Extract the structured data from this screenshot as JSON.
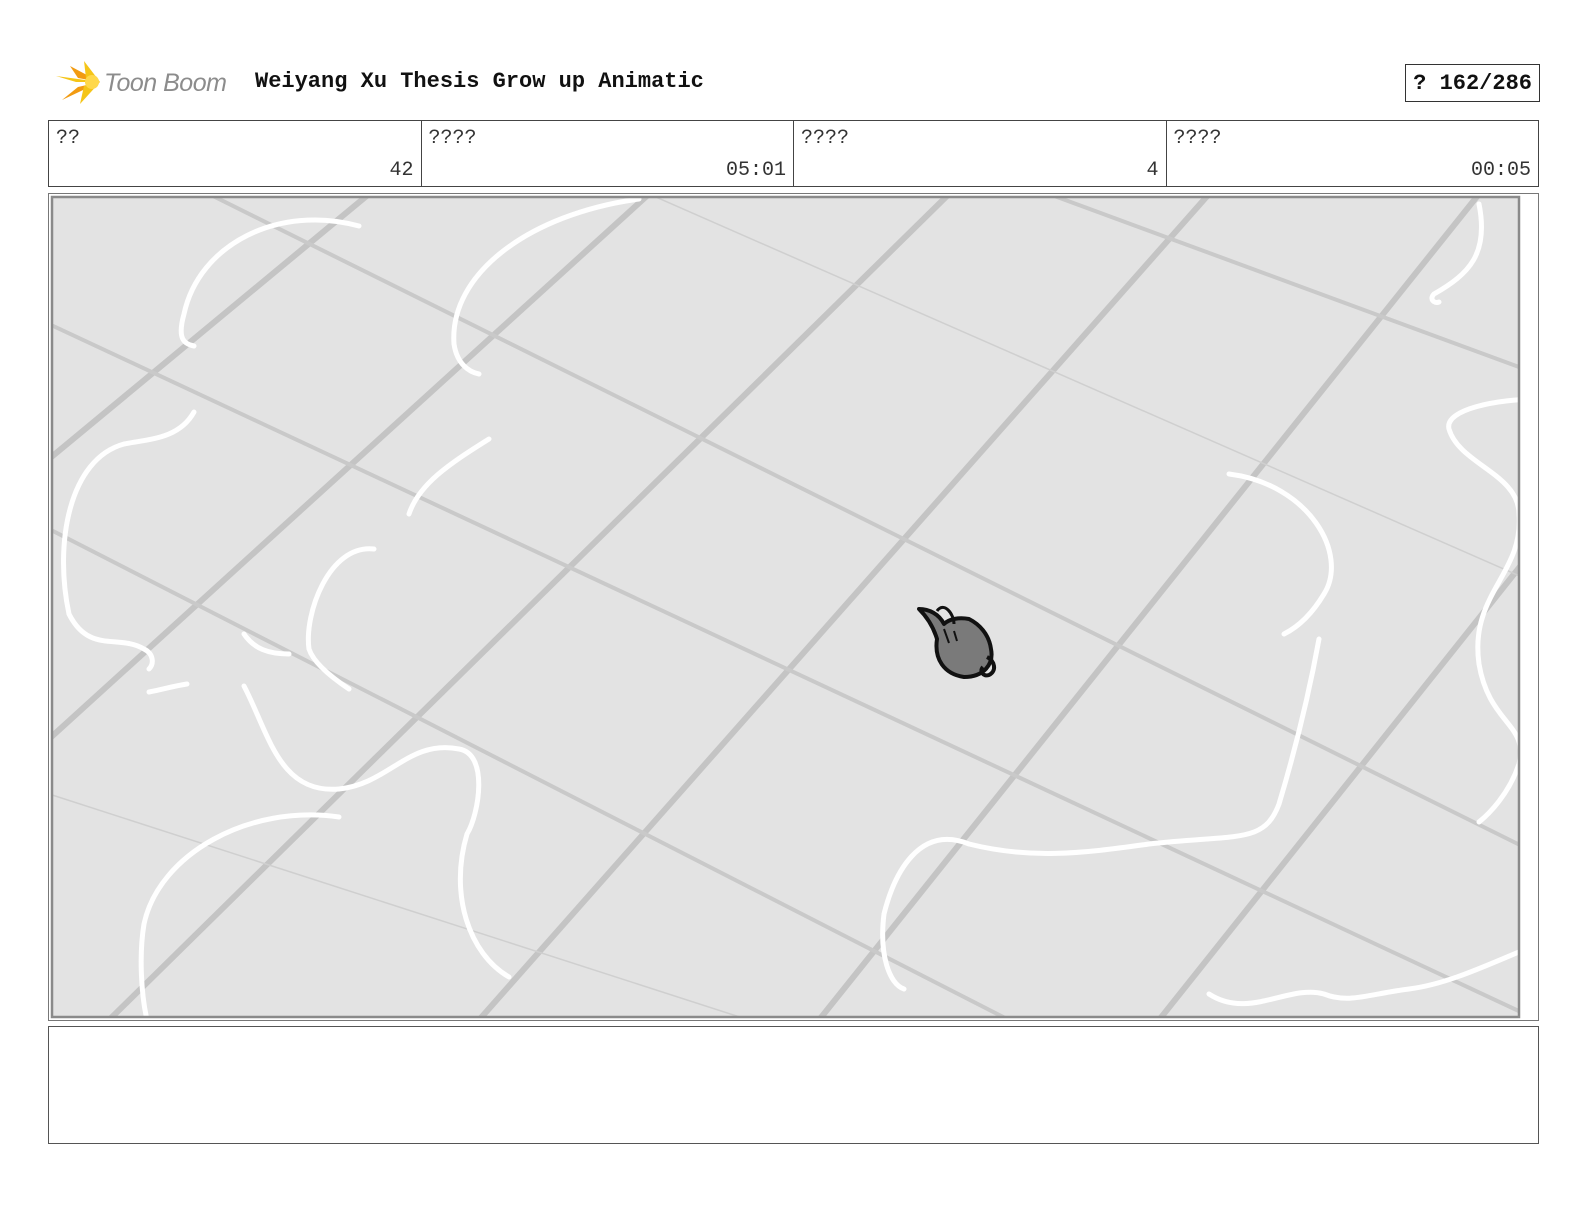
{
  "header": {
    "logo_text": "Toon Boom",
    "project_title": "Weiyang Xu Thesis Grow up Animatic",
    "page_counter": "? 162/286"
  },
  "info_fields": [
    {
      "label": "??",
      "value": "42"
    },
    {
      "label": "????",
      "value": "05:01"
    },
    {
      "label": "????",
      "value": "4"
    },
    {
      "label": "????",
      "value": "00:05"
    }
  ],
  "panel": {
    "icons": [
      "floor-grid-sketch",
      "character-topdown-sketch"
    ]
  },
  "caption": {
    "text": ""
  },
  "colors": {
    "logo_yellow": "#f5c518",
    "logo_orange": "#f29b11",
    "panel_fill": "#e3e3e3",
    "grid_line": "#c6c6c6",
    "sketch_white": "#ffffff",
    "character_fill": "#7a7a7a"
  }
}
